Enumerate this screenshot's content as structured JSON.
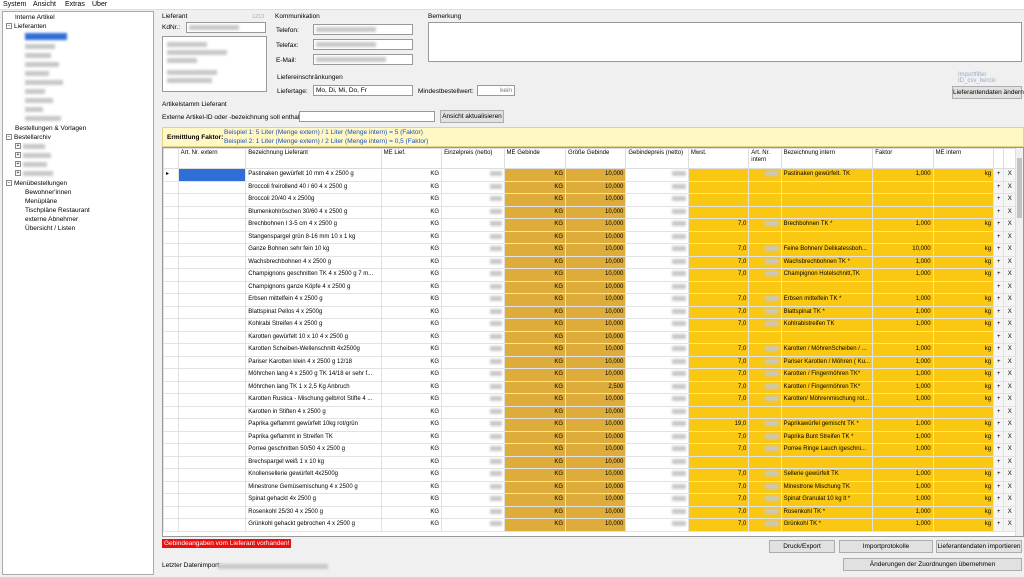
{
  "menu": [
    "System",
    "Ansicht",
    "Extras",
    "Über"
  ],
  "tree": {
    "interne_artikel": "Interne Artikel",
    "lieferanten": "Lieferanten",
    "bestellungen": "Bestellungen & Vorlagen",
    "bestellarchiv": "Bestellarchiv",
    "menuebestellungen": "Menübestellungen",
    "children": [
      "Bewohner'innen",
      "Menüpläne",
      "Tischpläne Restaurant",
      "externe Abnehmer",
      "Übersicht / Listen"
    ]
  },
  "lieferant": {
    "title": "Lieferant",
    "kdnr_label": "KdNr.:",
    "code": "1213"
  },
  "kommunikation": {
    "title": "Kommunikation",
    "telefon_label": "Telefon:",
    "telefax_label": "Telefax:",
    "email_label": "E-Mail:"
  },
  "bemerkung": {
    "title": "Bemerkung"
  },
  "liefer": {
    "title": "Liefereinschränkungen",
    "liefertage_label": "Liefertage:",
    "liefertage_value": "Mo, Di, Mi, Do, Fr",
    "mindest_label": "Mindestbestellwert:",
    "mindest_value": "kein"
  },
  "importfilter_label": "Importfilter ID_csv_bercki",
  "btn_lieferantendaten_aendern": "Lieferantendaten ändern",
  "artikelstamm_title": "Artikelstamm Lieferant",
  "search_label": "Externe Artikel-ID oder -bezeichnung soll enthalten:",
  "btn_ansicht": "Ansicht aktualisieren",
  "faktor": {
    "label": "Ermittlung Faktor:",
    "line1": "Beispiel 1:   5 Liter (Menge extern) / 1 Liter (Menge intern) = 5 (Faktor)",
    "line2": "Beispiel 2:   1 Liter (Menge extern) / 2 Liter (Menge intern) = 0,5 (Faktor)"
  },
  "columns": {
    "art_ext": "Art. Nr. extern",
    "bez_lief": "Bezeichnung Lieferant",
    "me_lief": "ME Lief.",
    "einzelpreis": "Einzelpreis (netto)",
    "me_gebinde": "ME Gebinde",
    "groesse": "Größe Gebinde",
    "gebindepreis": "Gebindepreis (netto)",
    "mwst": "Mwst.",
    "art_int": "Art. Nr. intern",
    "bez_int": "Bezeichnung intern",
    "faktor": "Faktor",
    "me_int": "ME intern"
  },
  "rows": [
    {
      "bez": "Pastinaken gewürfelt 10 mm 4 x 2500 g",
      "me": "KG",
      "meg": "KG",
      "gr": "10,000",
      "mw": "",
      "bi": "Pastinaken gewürfelt. TK",
      "fk": "1,000",
      "mi": "kg"
    },
    {
      "bez": "Broccoli freirollend 40 / 60 4 x 2500 g",
      "me": "KG",
      "meg": "KG",
      "gr": "10,000",
      "mw": "",
      "bi": "",
      "fk": "",
      "mi": ""
    },
    {
      "bez": "Broccoli 20/40 4 x 2500g",
      "me": "KG",
      "meg": "KG",
      "gr": "10,000",
      "mw": "",
      "bi": "",
      "fk": "",
      "mi": ""
    },
    {
      "bez": "Blumenkohlröschen 30/60 4 x 2500 g",
      "me": "KG",
      "meg": "KG",
      "gr": "10,000",
      "mw": "",
      "bi": "",
      "fk": "",
      "mi": ""
    },
    {
      "bez": "Brechbohnen I 3-5 cm 4 x 2500 g",
      "me": "KG",
      "meg": "KG",
      "gr": "10,000",
      "mw": "7,0",
      "bi": "Brechbohnen TK *",
      "fk": "1,000",
      "mi": "kg"
    },
    {
      "bez": "Stangenspargel grün 8-16 mm 10 x 1 kg",
      "me": "KG",
      "meg": "KG",
      "gr": "10,000",
      "mw": "",
      "bi": "",
      "fk": "",
      "mi": ""
    },
    {
      "bez": "Ganze Bohnen sehr fein 10 kg",
      "me": "KG",
      "meg": "KG",
      "gr": "10,000",
      "mw": "7,0",
      "bi": "Feine Bohnen/ Delikatessboh...",
      "fk": "10,000",
      "mi": "kg"
    },
    {
      "bez": "Wachsbrechbohnen 4 x 2500 g",
      "me": "KG",
      "meg": "KG",
      "gr": "10,000",
      "mw": "7,0",
      "bi": "Wachsbrechbohnen TK *",
      "fk": "1,000",
      "mi": "kg"
    },
    {
      "bez": "Champignons geschnitten TK 4 x 2500 g 7 m...",
      "me": "KG",
      "meg": "KG",
      "gr": "10,000",
      "mw": "7,0",
      "bi": "Champignon Hotelschnitt,TK",
      "fk": "1,000",
      "mi": "kg"
    },
    {
      "bez": "Champignons ganze Köpfe 4 x 2500 g",
      "me": "KG",
      "meg": "KG",
      "gr": "10,000",
      "mw": "",
      "bi": "",
      "fk": "",
      "mi": ""
    },
    {
      "bez": "Erbsen mittelfein 4 x 2500 g",
      "me": "KG",
      "meg": "KG",
      "gr": "10,000",
      "mw": "7,0",
      "bi": "Erbsen mittelfein TK *",
      "fk": "1,000",
      "mi": "kg"
    },
    {
      "bez": "Blattspinat Pellos 4 x 2500g",
      "me": "KG",
      "meg": "KG",
      "gr": "10,000",
      "mw": "7,0",
      "bi": "Blattspinat TK *",
      "fk": "1,000",
      "mi": "kg"
    },
    {
      "bez": "Kohlrabi Streifen 4 x 2500 g",
      "me": "KG",
      "meg": "KG",
      "gr": "10,000",
      "mw": "7,0",
      "bi": "Kohlrabistreifen TK",
      "fk": "1,000",
      "mi": "kg"
    },
    {
      "bez": "Karotten gewürfelt 10 x 10 4 x 2500 g",
      "me": "KG",
      "meg": "KG",
      "gr": "10,000",
      "mw": "",
      "bi": "",
      "fk": "",
      "mi": ""
    },
    {
      "bez": "Karotten Scheiben-Wellenschnitt 4x2500g",
      "me": "KG",
      "meg": "KG",
      "gr": "10,000",
      "mw": "7,0",
      "bi": "Karotten / MöhrenScheiben / ...",
      "fk": "1,000",
      "mi": "kg"
    },
    {
      "bez": "Pariser Karotten klein 4 x 2500 g 12/18",
      "me": "KG",
      "meg": "KG",
      "gr": "10,000",
      "mw": "7,0",
      "bi": "Pariser Karotten / Möhren ( Ku...",
      "fk": "1,000",
      "mi": "kg"
    },
    {
      "bez": "Möhrchen lang 4 x 2500 g TK 14/18 er sehr f...",
      "me": "KG",
      "meg": "KG",
      "gr": "10,000",
      "mw": "7,0",
      "bi": "Karotten / Fingermöhren TK*",
      "fk": "1,000",
      "mi": "kg"
    },
    {
      "bez": "Möhrchen lang TK 1 x 2,5 Kg Anbruch",
      "me": "KG",
      "meg": "KG",
      "gr": "2,500",
      "mw": "7,0",
      "bi": "Karotten / Fingermöhren TK*",
      "fk": "1,000",
      "mi": "kg"
    },
    {
      "bez": "Karotten Rustica - Mischung gelb/rot Stifte 4 ...",
      "me": "KG",
      "meg": "KG",
      "gr": "10,000",
      "mw": "7,0",
      "bi": "Karotten/ Möhrenmischung rot...",
      "fk": "1,000",
      "mi": "kg"
    },
    {
      "bez": "Karotten in Stiften 4 x 2500 g",
      "me": "KG",
      "meg": "KG",
      "gr": "10,000",
      "mw": "",
      "bi": "",
      "fk": "",
      "mi": ""
    },
    {
      "bez": "Paprika geflammt gewürfelt 10kg rot/grün",
      "me": "KG",
      "meg": "KG",
      "gr": "10,000",
      "mw": "19,0",
      "bi": "Paprikawürfel gemischt TK *",
      "fk": "1,000",
      "mi": "kg"
    },
    {
      "bez": "Paprika geflammt in Streifen TK",
      "me": "KG",
      "meg": "KG",
      "gr": "10,000",
      "mw": "7,0",
      "bi": "Paprika Bunt Streifen TK *",
      "fk": "1,000",
      "mi": "kg"
    },
    {
      "bez": "Porree geschnitten 50/50 4 x 2500 g",
      "me": "KG",
      "meg": "KG",
      "gr": "10,000",
      "mw": "7,0",
      "bi": "Porree Ringe Lauch /geschni...",
      "fk": "1,000",
      "mi": "kg"
    },
    {
      "bez": "Brechspargel weiß 1 x 10 kg",
      "me": "KG",
      "meg": "KG",
      "gr": "10,000",
      "mw": "",
      "bi": "",
      "fk": "",
      "mi": ""
    },
    {
      "bez": "Knollensellerie gewürfelt 4x2500g",
      "me": "KG",
      "meg": "KG",
      "gr": "10,000",
      "mw": "7,0",
      "bi": "Sellerie gewürfelt TK",
      "fk": "1,000",
      "mi": "kg"
    },
    {
      "bez": "Minestrone Gemüsemischung 4 x 2500 g",
      "me": "KG",
      "meg": "KG",
      "gr": "10,000",
      "mw": "7,0",
      "bi": "Minestrone Mischung TK",
      "fk": "1,000",
      "mi": "kg"
    },
    {
      "bez": "Spinat gehackt 4x 2500 g",
      "me": "KG",
      "meg": "KG",
      "gr": "10,000",
      "mw": "7,0",
      "bi": "Spinat Granulat 10 kg lt *",
      "fk": "1,000",
      "mi": "kg"
    },
    {
      "bez": "Rosenkohl 25/30 4 x 2500 g",
      "me": "KG",
      "meg": "KG",
      "gr": "10,000",
      "mw": "7,0",
      "bi": "Rosenkohl TK *",
      "fk": "1,000",
      "mi": "kg"
    },
    {
      "bez": "Grünkohl gehackt gebrochen 4 x 2500 g",
      "me": "KG",
      "meg": "KG",
      "gr": "10,000",
      "mw": "7,0",
      "bi": "Grünkohl TK *",
      "fk": "1,000",
      "mi": "kg"
    }
  ],
  "row_actions": {
    "add": "+",
    "remove": "X"
  },
  "warning": "Gebindeangaben vom Lieferant vorhanden!",
  "btn_druck": "Druck/Export",
  "btn_importprotokolle": "Importprotokolle",
  "btn_lieferantendaten_importieren": "Lieferantendaten importieren",
  "btn_aenderungen": "Änderungen der Zuordnungen übernehmen",
  "letzter_import_label": "Letzter Datenimport:",
  "colors": {
    "orange": "#deac3b",
    "yellow": "#fac712",
    "warning_bg": "#e81010",
    "faktor_text": "#1f4fbf"
  }
}
